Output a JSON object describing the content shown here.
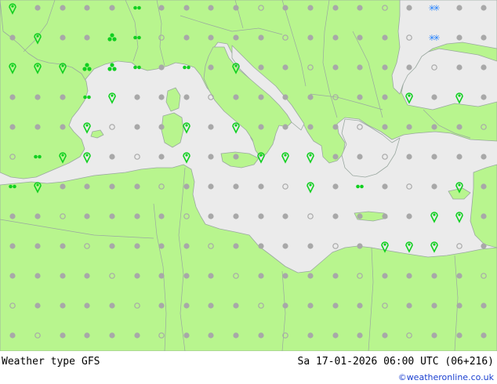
{
  "footer": {
    "title": "Weather type",
    "model": "GFS",
    "datetime": "Sa 17-01-2026 06:00 UTC (06+216)",
    "credit": "©weatheronline.co.uk"
  },
  "colors": {
    "land": "#b8f58e",
    "sea": "#ebebeb",
    "border": "#9aa8a0",
    "dot": "#a8a8a8",
    "rain": "#10d020",
    "snow": "#1f7fff",
    "link": "#1a3fd0"
  },
  "legend_symbols": {
    "rain": "green teardrop / shower symbol",
    "drizzle": "two green dots",
    "snow": "blue star pair",
    "cloud": "grey dot",
    "clear": "grey open circle"
  }
}
